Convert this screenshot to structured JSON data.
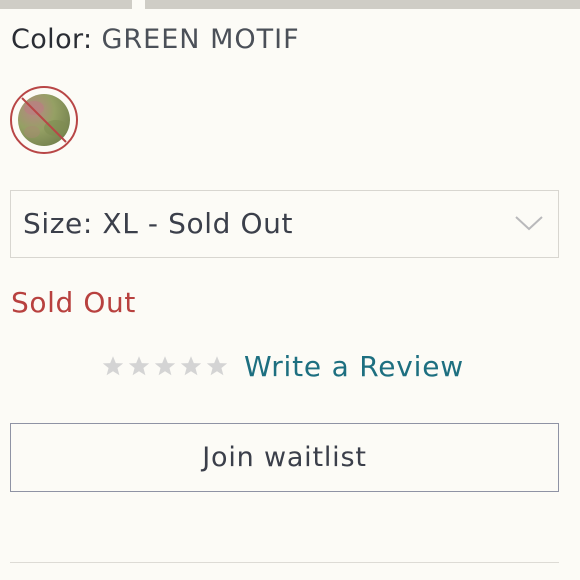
{
  "color": {
    "label": "Color:",
    "value": "GREEN MOTIF",
    "swatch_state": "sold-out",
    "swatch_colors": [
      "#8d9a5e",
      "#b3797b",
      "#6f7e4a"
    ],
    "swatch_strike_color": "#b84646"
  },
  "size": {
    "selected_text": "Size: XL - Sold Out",
    "chevron_icon": "chevron-down-icon"
  },
  "availability": {
    "status_text": "Sold Out",
    "status_color": "#b8413f"
  },
  "reviews": {
    "stars_filled": 0,
    "stars_total": 5,
    "star_icon": "star-icon",
    "link_text": "Write a Review",
    "link_color": "#1d6f80"
  },
  "actions": {
    "waitlist_label": "Join waitlist"
  }
}
